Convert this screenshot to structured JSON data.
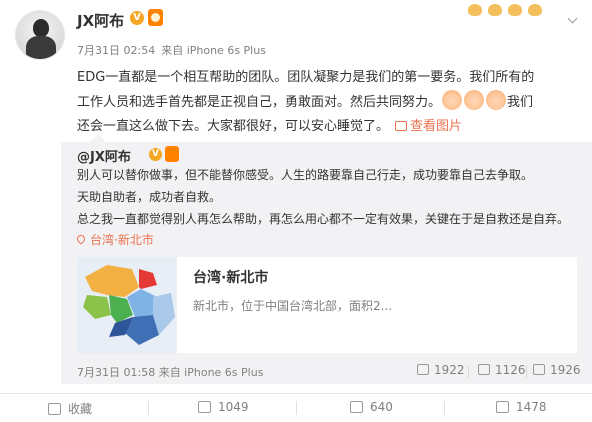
{
  "post": {
    "username": "JX阿布",
    "timestamp": "7月31日 02:54",
    "source": "来自 iPhone 6s Plus",
    "text_line1": "EDG一直都是一个相互帮助的团队。团队凝聚力是我们的第一要务。我们所有的",
    "text_line2": "工作人员和选手首先都是正视自己，勇敢面对。然后共同努力。",
    "text_line2_tail": "我们",
    "text_line3": "还会一直这么做下去。大家都很好，可以安心睡觉了。",
    "view_images_label": "查看图片"
  },
  "repost": {
    "username": "@JX阿布",
    "line1": "别人可以替你做事，但不能替你感受。人生的路要靠自己行走，成功要靠自己去争取。",
    "line2": "天助自助者，成功者自救。",
    "line3": "总之我一直都觉得别人再怎么帮助，再怎么用心都不一定有效果，关键在于是自救还是自弃。",
    "location": "台湾·新北市",
    "card_title": "台湾·新北市",
    "card_desc": "新北市，位于中国台湾北部，面积2...",
    "timestamp": "7月31日 01:58 来自 iPhone 6s Plus",
    "reposts": "1922",
    "comments": "1126",
    "likes": "1926"
  },
  "actions": {
    "favorite_label": "收藏",
    "repost_count": "1049",
    "comment_count": "640",
    "like_count": "1478"
  },
  "colors": {
    "link": "#eb7350",
    "meta": "#808080",
    "repost_bg": "#f2f2f5",
    "badge": "#f5a623"
  }
}
